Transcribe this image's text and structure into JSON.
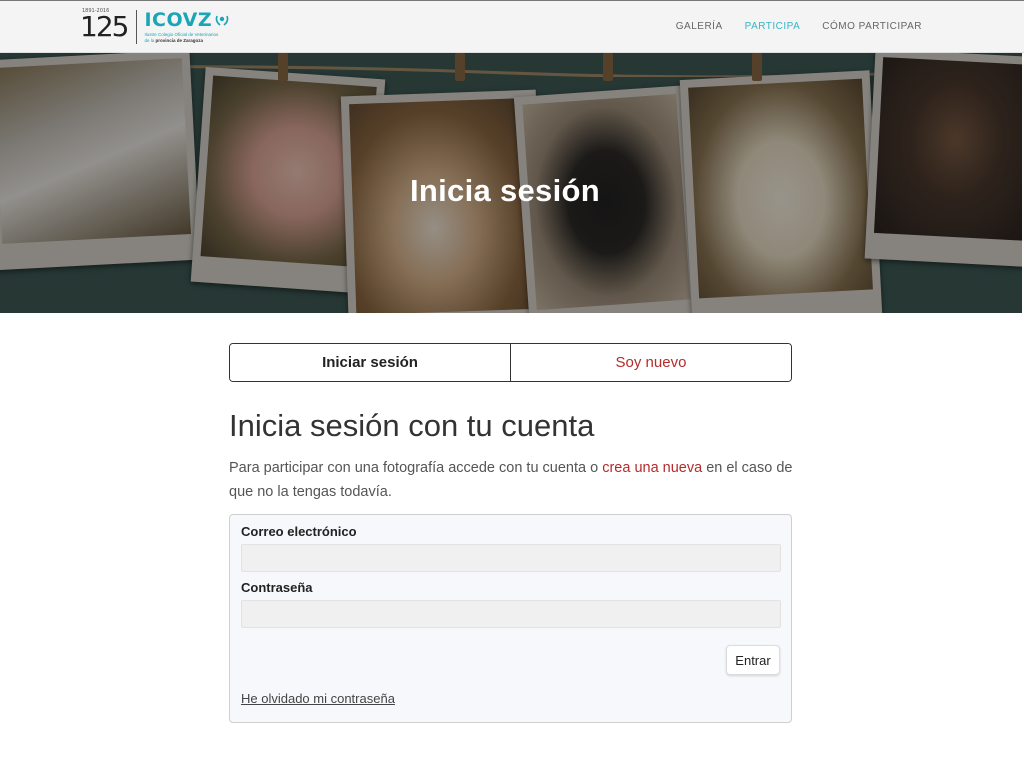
{
  "header": {
    "logo": {
      "number": "125",
      "tiny_text": "1891-2016",
      "word": "ICOVZ",
      "subtitle_line1": "Ilustre Colegio Oficial de Veterinarios",
      "subtitle_line2": "de la",
      "subtitle_line3": "provincia de Zaragoza"
    },
    "nav": [
      {
        "label": "GALERÍA"
      },
      {
        "label": "PARTICIPA"
      },
      {
        "label": "CÓMO PARTICIPAR"
      }
    ]
  },
  "hero": {
    "title": "Inicia sesión"
  },
  "tabs": {
    "login": "Iniciar sesión",
    "register": "Soy nuevo"
  },
  "content": {
    "headline": "Inicia sesión con tu cuenta",
    "intro_before": "Para participar con una fotografía accede con tu cuenta o ",
    "intro_link": "crea una nueva",
    "intro_after": " en el caso de que no la tengas todavía."
  },
  "form": {
    "email_label": "Correo electrónico",
    "email_value": "",
    "password_label": "Contraseña",
    "password_value": "",
    "submit_label": "Entrar",
    "forgot_label": "He olvidado mi contraseña"
  },
  "colors": {
    "accent_teal": "#35b7c4",
    "link_red": "#b52b2b"
  }
}
